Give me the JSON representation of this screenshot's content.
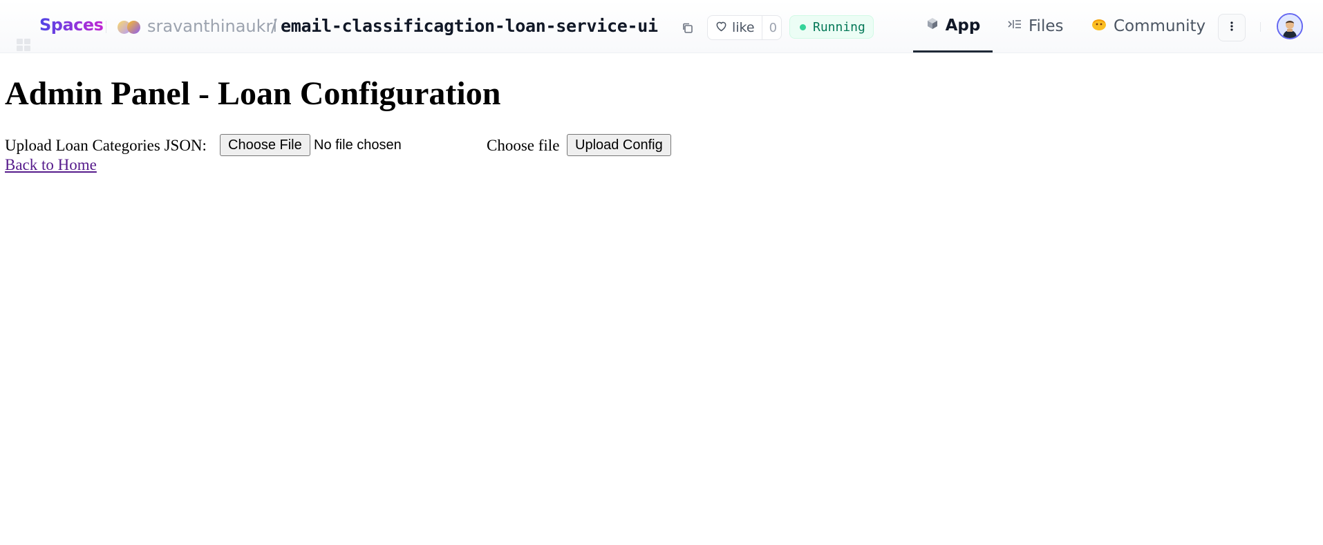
{
  "header": {
    "spaces_label": "Spaces",
    "owner": "sravanthinaukri",
    "separator": "/",
    "repo": "email-classificagtion-loan-service-ui",
    "like_label": "like",
    "like_count": "0",
    "status": "Running",
    "tabs": [
      {
        "label": "App",
        "icon": "cube-icon",
        "active": true
      },
      {
        "label": "Files",
        "icon": "files-icon",
        "active": false
      },
      {
        "label": "Community",
        "icon": "hug-icon",
        "active": false
      }
    ],
    "colors": {
      "status_green": "#34d399",
      "spaces_gradient": [
        "#4f46e5",
        "#c026d3"
      ]
    }
  },
  "main": {
    "title": "Admin Panel - Loan Configuration",
    "upload_label": "Upload Loan Categories JSON:",
    "file_button": "Choose File",
    "file_status": "No file chosen",
    "choose_label": "Choose file",
    "submit_button": "Upload Config",
    "back_link": "Back to Home"
  }
}
